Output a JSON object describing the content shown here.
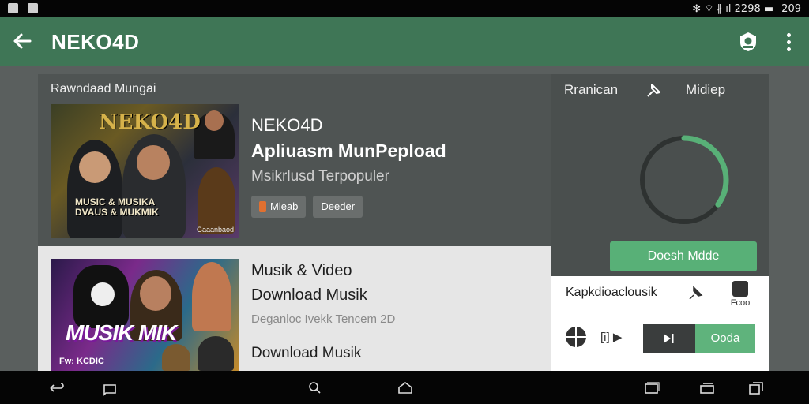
{
  "status_bar": {
    "right_text": "✻ ⌔ ∦ ıl 2298 ▬",
    "time": "209"
  },
  "app_bar": {
    "title": "NEKO4D",
    "back_icon": "arrow-left-icon",
    "action_icon": "badge-icon",
    "menu_icon": "more-vert-icon",
    "color": "#3f7656"
  },
  "main": {
    "section_title": "Rawndaad Mungai",
    "items": [
      {
        "poster_title": "NEKO4D",
        "poster_sub": "MUSIC & MUSIKA\nDVAUS & MUKMIK",
        "poster_foot": "Gaaanbaod",
        "line1": "NEKO4D",
        "line2": "Apliuasm MunPeplоad",
        "line3": "Msikrlusd Terpopuler",
        "chips": [
          "Mleab",
          "Deeder"
        ]
      },
      {
        "poster_title": "MUSIK MIK",
        "poster_foot": "Fw: KCDIC",
        "line1": "Musik & Video",
        "line2": "Download Musik",
        "line3": "Deganloc Ivekk Tencem 2D",
        "line4": "Download Musik"
      }
    ]
  },
  "side_panel": {
    "header_left": "Rranican",
    "header_icon": "pin-icon",
    "header_right": "Midiep",
    "progress": 0.35,
    "accent": "#58b077",
    "button_label": "Doesh Mdde",
    "sub": {
      "label": "Kapkdioaclousik",
      "download_label": "Fcoo",
      "play_label": "[i] ▶",
      "green_label": "Ooda"
    }
  },
  "nav_bar": {
    "icons": [
      "back-icon",
      "tab-icon",
      "search-icon",
      "home-icon",
      "recents-icon",
      "window-icon",
      "copy-icon"
    ]
  }
}
